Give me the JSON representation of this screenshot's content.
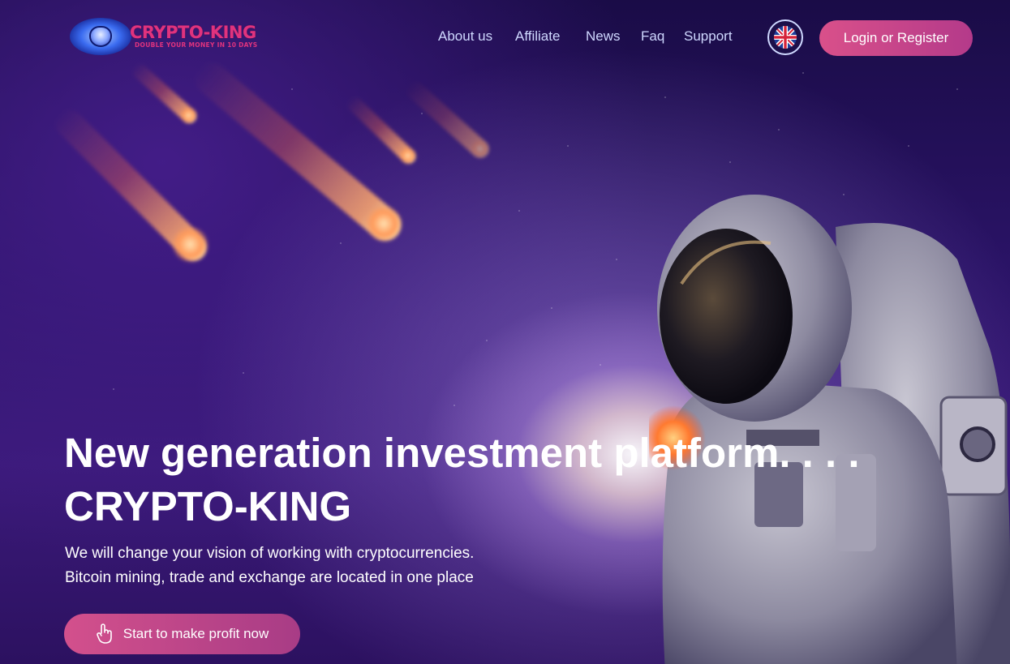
{
  "brand": {
    "name": "CRYPTO-KING",
    "tagline": "DOUBLE YOUR MONEY IN 10 DAYS",
    "accent": "#e0337e"
  },
  "nav": {
    "items": [
      "About us",
      "Affiliate",
      "News",
      "Faq",
      "Support"
    ]
  },
  "language": {
    "icon": "uk-flag-icon"
  },
  "login_button": "Login or Register",
  "hero": {
    "title_line1": "New generation investment platform. . . .",
    "title_line2": "CRYPTO-KING",
    "subtitle_line1": "We will change your vision of working with cryptocurrencies.",
    "subtitle_line2": "Bitcoin mining, trade and exchange are located in one place",
    "cta_label": "Start to make profit now",
    "cta_icon": "pointer-hand-icon"
  },
  "colors": {
    "button_gradient_start": "#d9508a",
    "button_gradient_end": "#b43a8a",
    "nav_text": "#cfd8ff"
  }
}
